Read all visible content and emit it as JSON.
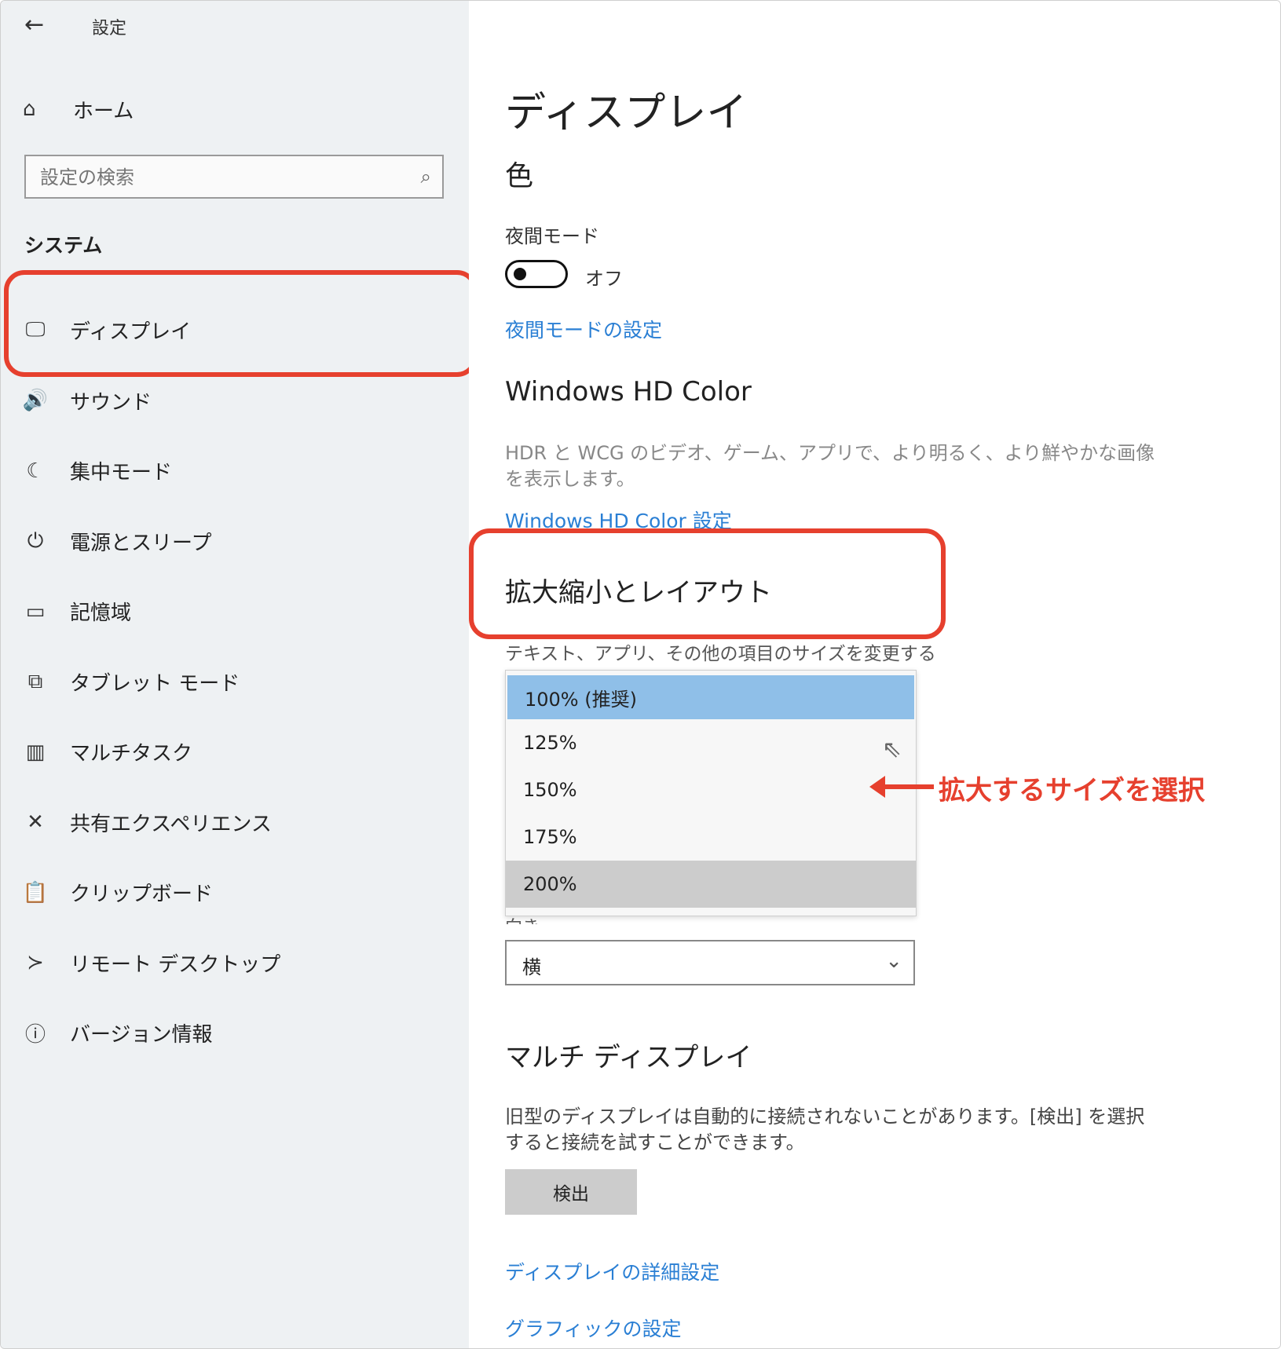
{
  "app": {
    "title": "設定",
    "back_icon": "back-arrow-icon"
  },
  "sidebar": {
    "home_label": "ホーム",
    "search_placeholder": "設定の検索",
    "section": "システム",
    "items": [
      {
        "label": "ディスプレイ",
        "icon": "🖵"
      },
      {
        "label": "サウンド",
        "icon": "🔊"
      },
      {
        "label": "集中モード",
        "icon": "☾"
      },
      {
        "label": "電源とスリープ",
        "icon": "⏻"
      },
      {
        "label": "記憶域",
        "icon": "▭"
      },
      {
        "label": "タブレット モード",
        "icon": "⧉"
      },
      {
        "label": "マルチタスク",
        "icon": "▥"
      },
      {
        "label": "共有エクスペリエンス",
        "icon": "✕"
      },
      {
        "label": "クリップボード",
        "icon": "📋"
      },
      {
        "label": "リモート デスクトップ",
        "icon": "≻"
      },
      {
        "label": "バージョン情報",
        "icon": "ⓘ"
      }
    ]
  },
  "main": {
    "title": "ディスプレイ",
    "color_heading": "色",
    "night_mode_label": "夜間モード",
    "night_mode_state": "オフ",
    "night_mode_link": "夜間モードの設定",
    "hd_heading": "Windows HD Color",
    "hd_desc": "HDR と WCG のビデオ、ゲーム、アプリで、より明るく、より鮮やかな画像を表示します。",
    "hd_link": "Windows HD Color 設定",
    "scale_heading": "拡大縮小とレイアウト",
    "scale_desc": "テキスト、アプリ、その他の項目のサイズを変更する",
    "scale_options": [
      "100% (推奨)",
      "125%",
      "150%",
      "175%",
      "200%"
    ],
    "orientation_label": "向き",
    "orientation_value": "横",
    "multi_heading": "マルチ ディスプレイ",
    "multi_desc": "旧型のディスプレイは自動的に接続されないことがあります。[検出] を選択すると接続を試すことができます。",
    "detect_button": "検出",
    "advanced_link": "ディスプレイの詳細設定",
    "graphics_link": "グラフィックの設定"
  },
  "annotation": {
    "text": "拡大するサイズを選択",
    "color": "#e6402e"
  },
  "colors": {
    "accent_link": "#2a7fd4",
    "selected_option": "#8fbfe8",
    "hover_option": "#cccccc",
    "sidebar_bg": "#eef1f3"
  }
}
